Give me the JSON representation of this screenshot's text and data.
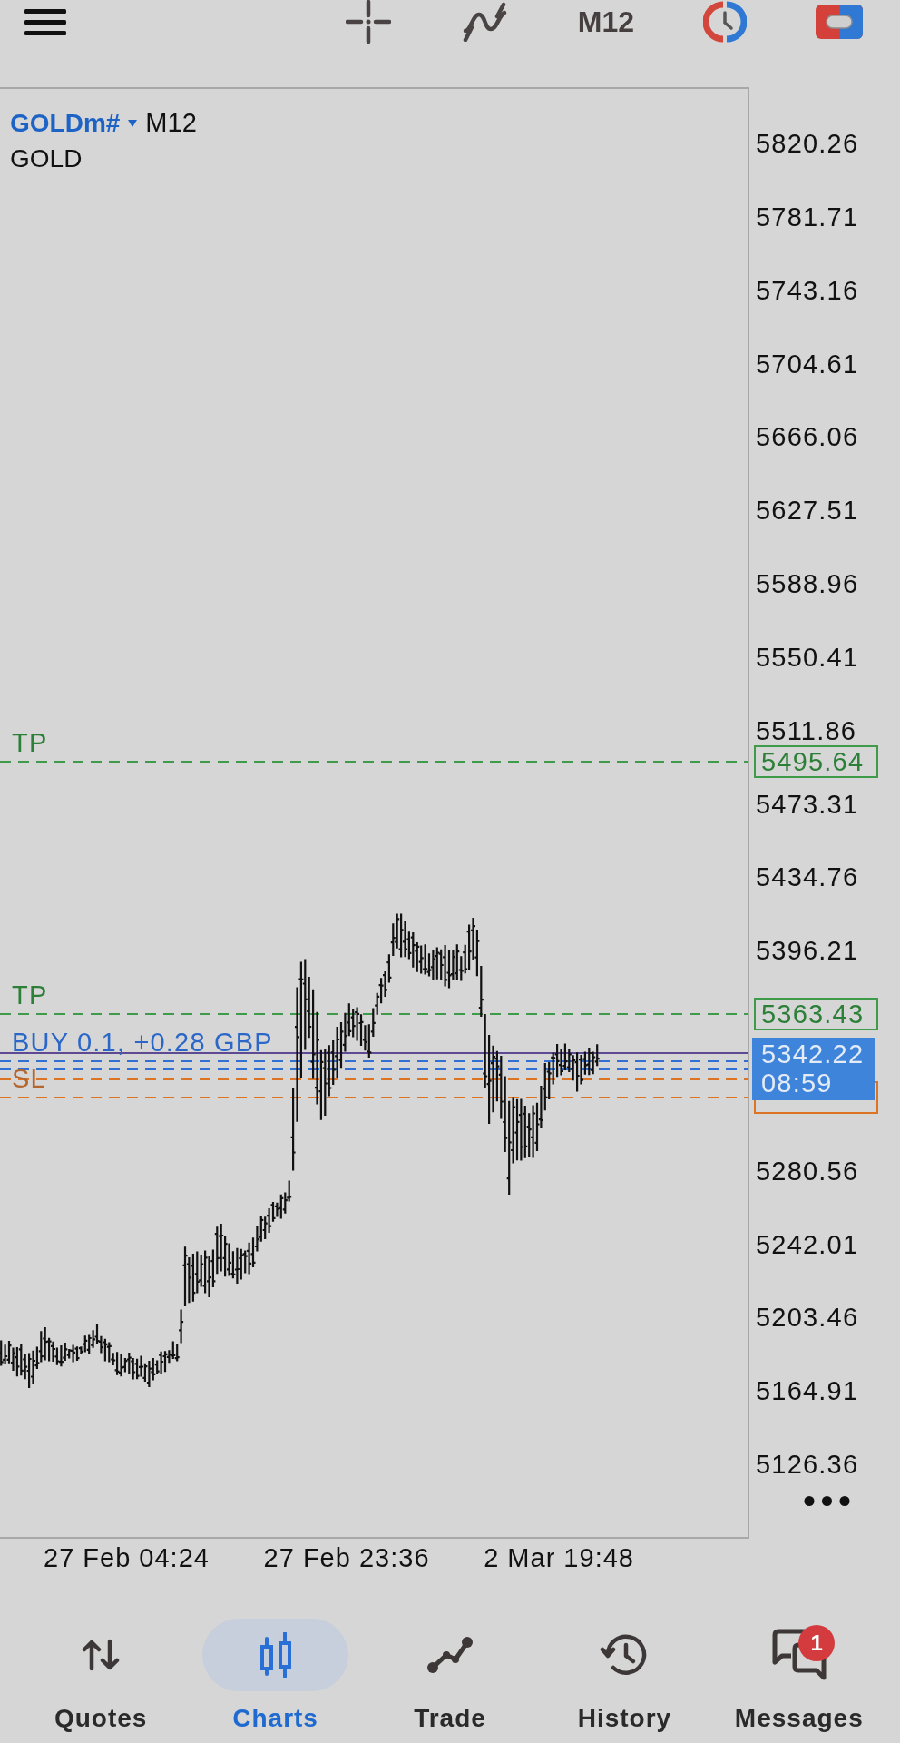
{
  "top_bar": {
    "timeframe": "M12"
  },
  "chart": {
    "symbol": "GOLDm#",
    "timeframe": "M12",
    "description": "GOLD",
    "price_axis": [
      "5820.26",
      "5781.71",
      "5743.16",
      "5704.61",
      "5666.06",
      "5627.51",
      "5588.96",
      "5550.41",
      "5511.86",
      "5473.31",
      "5434.76",
      "5396.21",
      "5280.56",
      "5242.01",
      "5203.46",
      "5164.91",
      "5126.36"
    ],
    "orders": [
      {
        "kind": "tp",
        "label": "TP",
        "price_tag": "5495.64"
      },
      {
        "kind": "tp",
        "label": "TP",
        "price_tag": "5363.43"
      },
      {
        "kind": "entry",
        "label": "BUY 0.1, +0.28 GBP"
      },
      {
        "kind": "entry"
      },
      {
        "kind": "sl"
      },
      {
        "kind": "sl",
        "label": "SL"
      }
    ],
    "covered_tags": [
      {
        "kind": "sl"
      }
    ],
    "current_price": {
      "price": "5342.22",
      "countdown": "08:59"
    },
    "time_axis": [
      "27 Feb 04:24",
      "27 Feb 23:36",
      "2 Mar 19:48"
    ]
  },
  "bottom_nav": [
    {
      "label": "Quotes",
      "selected": false
    },
    {
      "label": "Charts",
      "selected": true
    },
    {
      "label": "Trade",
      "selected": false
    },
    {
      "label": "History",
      "selected": false
    },
    {
      "label": "Messages",
      "selected": false,
      "badge": "1"
    }
  ]
}
